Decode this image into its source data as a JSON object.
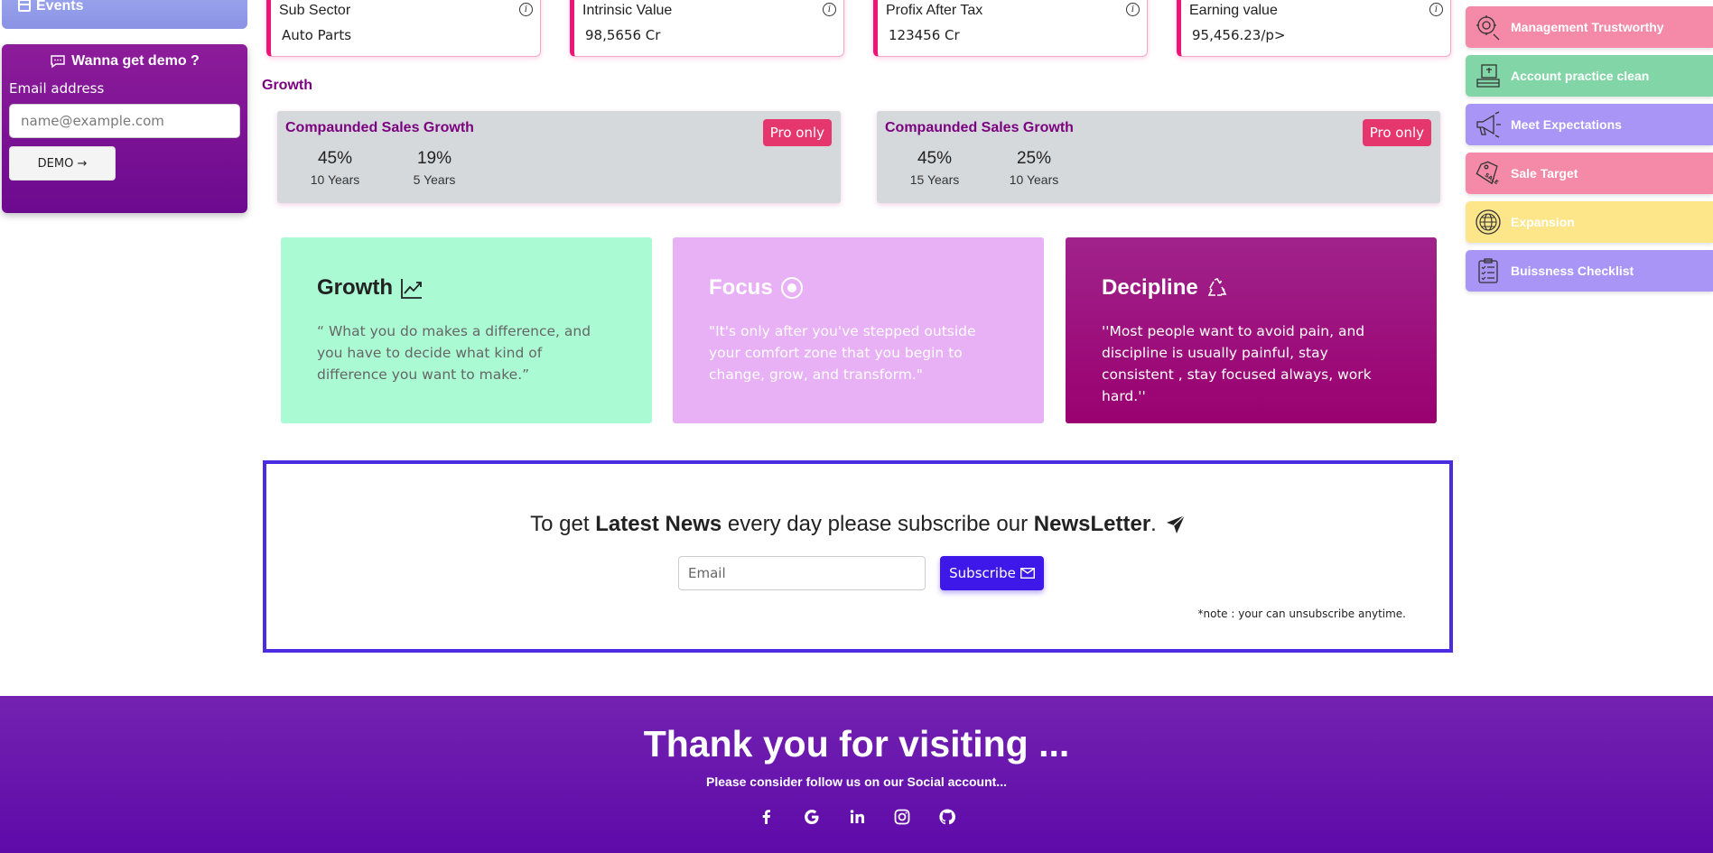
{
  "left_sidebar": {
    "events_label": "Events",
    "demo": {
      "title": "Wanna get demo ?",
      "email_label": "Email address",
      "email_placeholder": "name@example.com",
      "button_label": "DEMO →"
    }
  },
  "stats": [
    {
      "label": "Sub Sector",
      "value": "Auto Parts"
    },
    {
      "label": "Intrinsic Value",
      "value": "98,5656 Cr"
    },
    {
      "label": "Profix After Tax",
      "value": "123456 Cr"
    },
    {
      "label": "Earning value",
      "value": "95,456.23/p>"
    }
  ],
  "growth": {
    "heading": "Growth",
    "cards": [
      {
        "title": "Compaunded Sales Growth",
        "badge": "Pro only",
        "stats": [
          {
            "percent": "45%",
            "period": "10 Years"
          },
          {
            "percent": "19%",
            "period": "5 Years"
          }
        ]
      },
      {
        "title": "Compaunded Sales Growth",
        "badge": "Pro only",
        "stats": [
          {
            "percent": "45%",
            "period": "15 Years"
          },
          {
            "percent": "25%",
            "period": "10 Years"
          }
        ]
      }
    ]
  },
  "quotes": [
    {
      "title": "Growth",
      "icon": "trending-up-icon",
      "text": "“ What you do makes a difference, and you have to decide what kind of difference you want to make.”"
    },
    {
      "title": "Focus",
      "icon": "target-icon",
      "text": "\"It's only after you've stepped outside your comfort zone that you begin to change, grow, and transform.\""
    },
    {
      "title": "Decipline",
      "icon": "recycle-icon",
      "text": "''Most people want to avoid pain, and discipline is usually painful, stay consistent , stay focused always, work hard.''"
    }
  ],
  "newsletter": {
    "prefix": "To get ",
    "bold1": "Latest News",
    "middle": " every day please subscribe our ",
    "bold2": "NewsLetter",
    "suffix": ".",
    "email_placeholder": "Email",
    "button_label": "Subscribe",
    "note": "*note : your can unsubscribe anytime."
  },
  "right_sidebar": {
    "items": [
      {
        "label": "Management Trustworthy",
        "color": "#f48aa8",
        "icon": "management-icon"
      },
      {
        "label": "Account practice clean",
        "color": "#82d5a7",
        "icon": "account-icon"
      },
      {
        "label": "Meet Expectations",
        "color": "#a995f5",
        "icon": "megaphone-icon"
      },
      {
        "label": "Sale Target",
        "color": "#f48aa8",
        "icon": "sale-tag-icon"
      },
      {
        "label": "Expansion",
        "color": "#fde68a",
        "icon": "globe-icon"
      },
      {
        "label": "Buissness Checklist",
        "color": "#a995f5",
        "icon": "checklist-icon"
      }
    ]
  },
  "footer": {
    "title": "Thank you for visiting ...",
    "subtitle": "Please consider follow us on our Social account...",
    "socials": [
      "facebook-icon",
      "google-icon",
      "linkedin-icon",
      "instagram-icon",
      "github-icon"
    ]
  }
}
